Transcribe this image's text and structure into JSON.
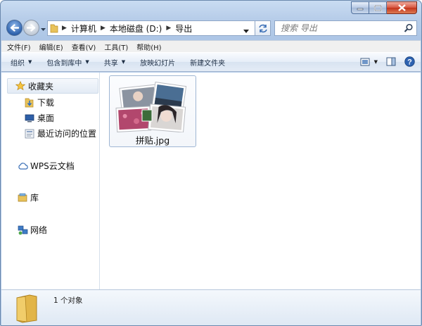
{
  "window": {
    "caption_buttons": [
      "minimize",
      "maximize",
      "close"
    ]
  },
  "address": {
    "crumbs": [
      "计算机",
      "本地磁盘 (D:)",
      "导出"
    ]
  },
  "search": {
    "placeholder": "搜索 导出"
  },
  "menu": {
    "items": [
      "文件(F)",
      "编辑(E)",
      "查看(V)",
      "工具(T)",
      "帮助(H)"
    ]
  },
  "toolbar": {
    "organize": "组织",
    "include_in_library": "包含到库中",
    "share": "共享",
    "slideshow": "放映幻灯片",
    "new_folder": "新建文件夹"
  },
  "nav": {
    "favorites": "收藏夹",
    "downloads": "下载",
    "desktop": "桌面",
    "recent": "最近访问的位置",
    "wps_cloud": "WPS云文档",
    "library": "库",
    "network": "网络"
  },
  "files": [
    {
      "name": "拼贴.jpg"
    }
  ],
  "status": {
    "count_text": "1 个对象"
  },
  "colors": {
    "accent": "#2f63ad",
    "close": "#c2341c",
    "folder": "#e8c25a"
  }
}
